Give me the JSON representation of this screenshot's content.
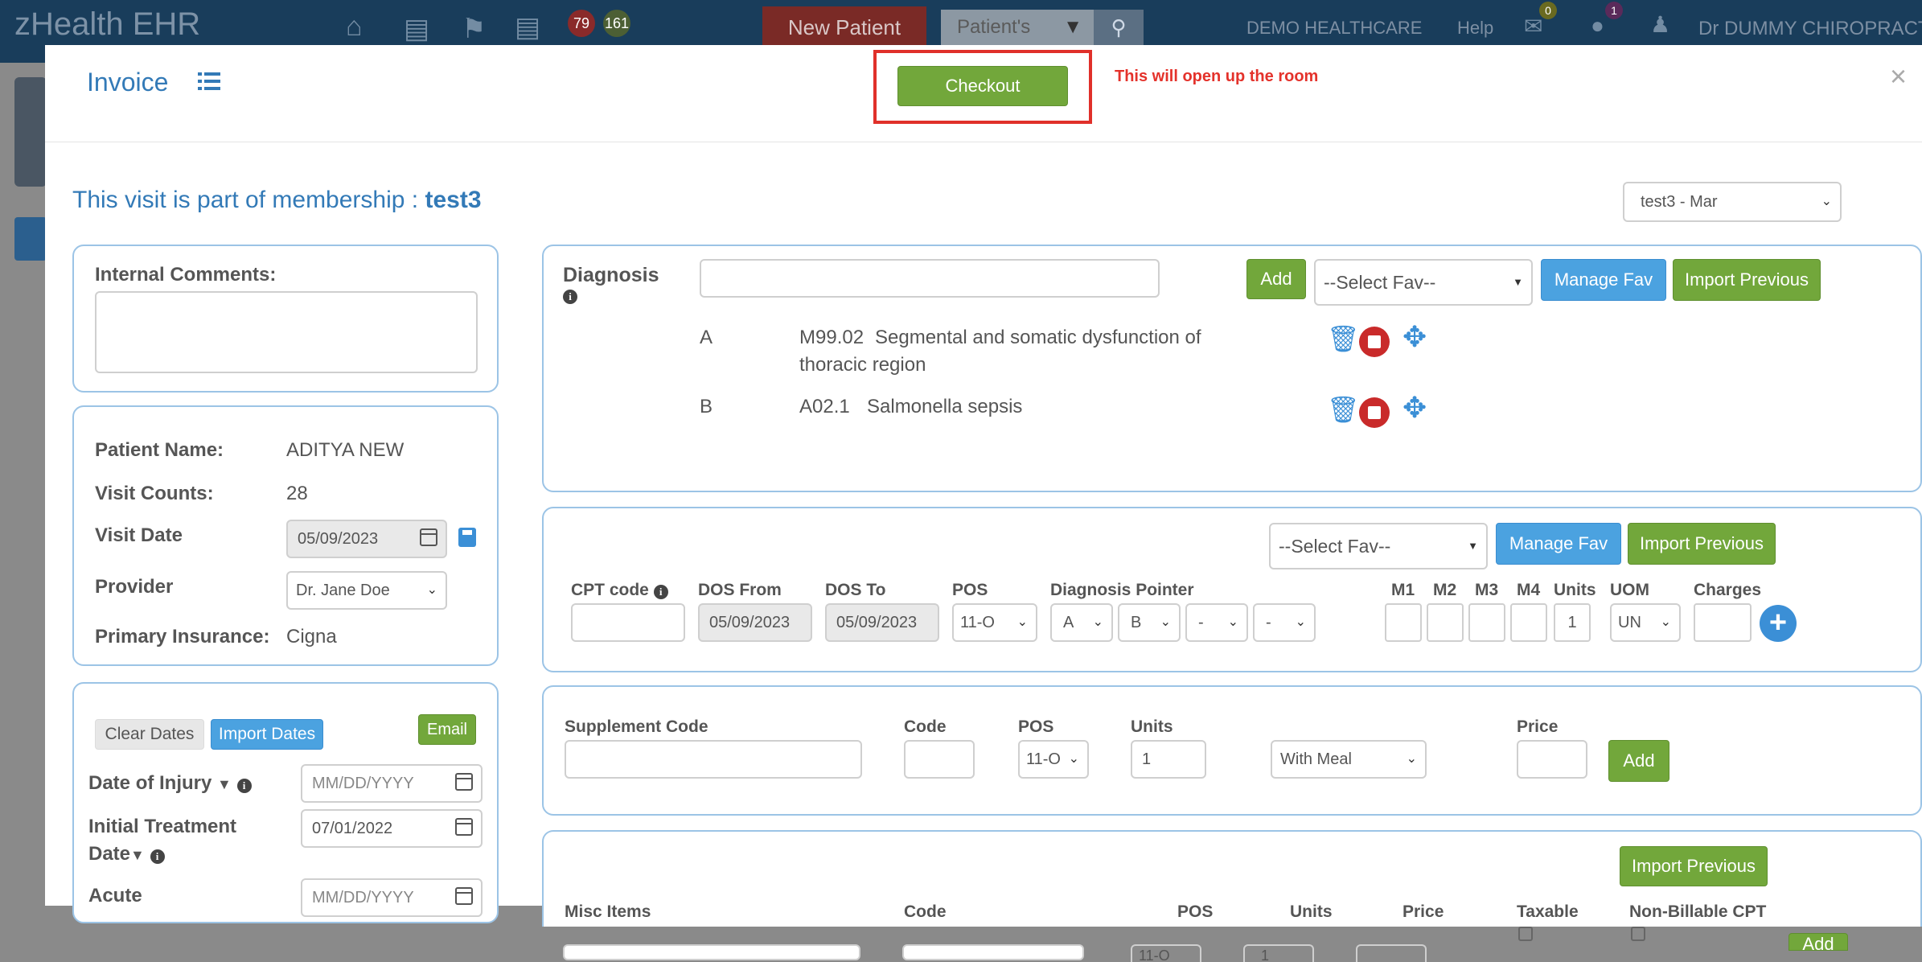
{
  "app": {
    "brand": "zHealth EHR",
    "badge_red": "79",
    "badge_green": "161",
    "new_patient": "New Patient",
    "patient_select": "Patient's",
    "org": "DEMO HEALTHCARE",
    "help": "Help",
    "mail_count": "0",
    "chat_count": "1",
    "user": "Dr DUMMY CHIROPRACTOR"
  },
  "modal": {
    "title": "Invoice",
    "checkout": "Checkout",
    "annotation": "This will open up the room",
    "close": "×",
    "membership_text": "This visit is part of membership : ",
    "membership_name": "test3",
    "membership_select": "test3 - Mar"
  },
  "comments": {
    "label": "Internal Comments:"
  },
  "patient": {
    "name_label": "Patient Name:",
    "name": "ADITYA NEW",
    "visits_label": "Visit Counts:",
    "visits": "28",
    "visit_date_label": "Visit Date",
    "visit_date": "05/09/2023",
    "provider_label": "Provider",
    "provider": "Dr. Jane Doe",
    "insurance_label": "Primary Insurance:",
    "insurance": "Cigna"
  },
  "dates": {
    "clear": "Clear Dates",
    "import": "Import Dates",
    "email": "Email",
    "injury_label": "Date of Injury",
    "injury_placeholder": "MM/DD/YYYY",
    "initial_label_1": "Initial Treatment",
    "initial_label_2": "Date",
    "initial_value": "07/01/2022",
    "acute_label": "Acute",
    "acute_placeholder": "MM/DD/YYYY"
  },
  "diagnosis": {
    "label": "Diagnosis",
    "add": "Add",
    "fav": "--Select Fav--",
    "manage": "Manage Fav",
    "import": "Import Previous",
    "rows": [
      {
        "letter": "A",
        "code": "M99.02",
        "desc_1": "Segmental and somatic dysfunction of",
        "desc_2": "thoracic region"
      },
      {
        "letter": "B",
        "code": "A02.1",
        "desc_1": "Salmonella sepsis",
        "desc_2": ""
      }
    ]
  },
  "cpt": {
    "fav": "--Select Fav--",
    "manage": "Manage Fav",
    "import": "Import Previous",
    "cpt_label": "CPT code",
    "dos_from_label": "DOS From",
    "dos_from": "05/09/2023",
    "dos_to_label": "DOS To",
    "dos_to": "05/09/2023",
    "pos_label": "POS",
    "pos": "11-O",
    "pointer_label": "Diagnosis Pointer",
    "pointers": [
      "A",
      "B",
      "-",
      "-"
    ],
    "m1": "M1",
    "m2": "M2",
    "m3": "M3",
    "m4": "M4",
    "units_label": "Units",
    "units": "1",
    "uom_label": "UOM",
    "uom": "UN",
    "charges_label": "Charges"
  },
  "supplement": {
    "label": "Supplement Code",
    "code_label": "Code",
    "pos_label": "POS",
    "pos": "11-O",
    "units_label": "Units",
    "units": "1",
    "meal": "With Meal",
    "price_label": "Price",
    "add": "Add"
  },
  "misc": {
    "import": "Import Previous",
    "label": "Misc Items",
    "code_label": "Code",
    "pos_label": "POS",
    "pos": "11-O",
    "units_label": "Units",
    "units": "1",
    "price_label": "Price",
    "taxable_label": "Taxable",
    "nonbill_label": "Non-Billable CPT",
    "add": "Add"
  },
  "colors": {
    "accent": "#337ab7",
    "green": "#72a73b",
    "blue": "#4ba2e0",
    "red_annotation": "#e4322b"
  }
}
